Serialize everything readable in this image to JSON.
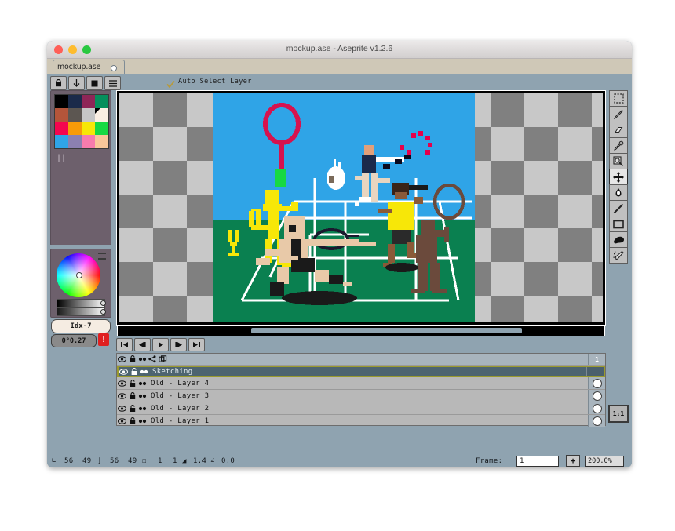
{
  "window": {
    "title": "mockup.ase - Aseprite v1.2.6",
    "traffic_lights": [
      "close",
      "minimize",
      "maximize"
    ]
  },
  "tab": {
    "label": "mockup.ase",
    "modified_indicator": "modified-dot"
  },
  "context_toolbar": {
    "buttons": [
      {
        "name": "lock-icon",
        "label": "lock"
      },
      {
        "name": "move-down-icon",
        "label": "down"
      },
      {
        "name": "fill-square-icon",
        "label": "square"
      },
      {
        "name": "menu-icon",
        "label": "menu"
      }
    ],
    "auto_select_layer": {
      "label": "Auto Select Layer",
      "checked": true
    }
  },
  "palette": {
    "colors": [
      "#000000",
      "#1b2a4a",
      "#8e2657",
      "#068f5c",
      "#b4553a",
      "#5c5651",
      "#c6c6c6",
      "#fbefe3",
      "#f5054f",
      "#f79b08",
      "#f7e708",
      "#17d943",
      "#2fa4e7",
      "#8b80b0",
      "#f77cad",
      "#f9c79a"
    ],
    "selected_index": 7,
    "selected_label": "Idx-7",
    "angle_label": "0°0.27",
    "warning_badge": "!"
  },
  "tools": [
    {
      "name": "rectangular-marquee-icon",
      "label": "Rectangular Marquee",
      "selected": false
    },
    {
      "name": "pencil-icon",
      "label": "Pencil",
      "selected": false
    },
    {
      "name": "eraser-icon",
      "label": "Eraser",
      "selected": false
    },
    {
      "name": "eyedropper-icon",
      "label": "Eyedropper",
      "selected": false
    },
    {
      "name": "zoom-icon",
      "label": "Zoom",
      "selected": false
    },
    {
      "name": "move-icon",
      "label": "Move",
      "selected": true
    },
    {
      "name": "paint-bucket-icon",
      "label": "Paint Bucket",
      "selected": false
    },
    {
      "name": "line-icon",
      "label": "Line",
      "selected": false
    },
    {
      "name": "rectangle-icon",
      "label": "Rectangle",
      "selected": false
    },
    {
      "name": "blur-smudge-icon",
      "label": "Blur",
      "selected": false
    },
    {
      "name": "spray-icon",
      "label": "Spray",
      "selected": false
    }
  ],
  "zoom_reset_button": "1:1",
  "animation_controls": [
    {
      "name": "go-to-first-frame-button",
      "glyph": "first"
    },
    {
      "name": "previous-frame-button",
      "glyph": "prev"
    },
    {
      "name": "play-button",
      "glyph": "play"
    },
    {
      "name": "next-frame-button",
      "glyph": "next"
    },
    {
      "name": "go-to-last-frame-button",
      "glyph": "last"
    }
  ],
  "layers": {
    "frame_header": "1",
    "rows": [
      {
        "name": "Sketching",
        "selected": true,
        "visible": true,
        "locked": true,
        "has_key": false
      },
      {
        "name": "Old - Layer 4",
        "selected": false,
        "visible": true,
        "locked": true,
        "has_key": true
      },
      {
        "name": "Old - Layer 3",
        "selected": false,
        "visible": true,
        "locked": true,
        "has_key": true
      },
      {
        "name": "Old - Layer 2",
        "selected": false,
        "visible": true,
        "locked": true,
        "has_key": true
      },
      {
        "name": "Old - Layer 1",
        "selected": false,
        "visible": true,
        "locked": true,
        "has_key": true
      }
    ]
  },
  "status_bar": {
    "cursor_x": "56",
    "cursor_y": "49",
    "size_w": "56",
    "size_h": "49",
    "grid_x": "1",
    "grid_y": "1",
    "brush_size": "1.4",
    "angle": "0.0",
    "frame_label": "Frame:",
    "frame_value": "1",
    "add_frame_button": "+",
    "zoom_value": "200.0%"
  },
  "canvas": {
    "sky_color": "#2fa4e7",
    "court_color": "#0a8050",
    "line_color": "#ffffff",
    "checker_light": "#c8c8c8",
    "checker_dark": "#808080",
    "artwork_title": "badminton pixel art sketch"
  }
}
